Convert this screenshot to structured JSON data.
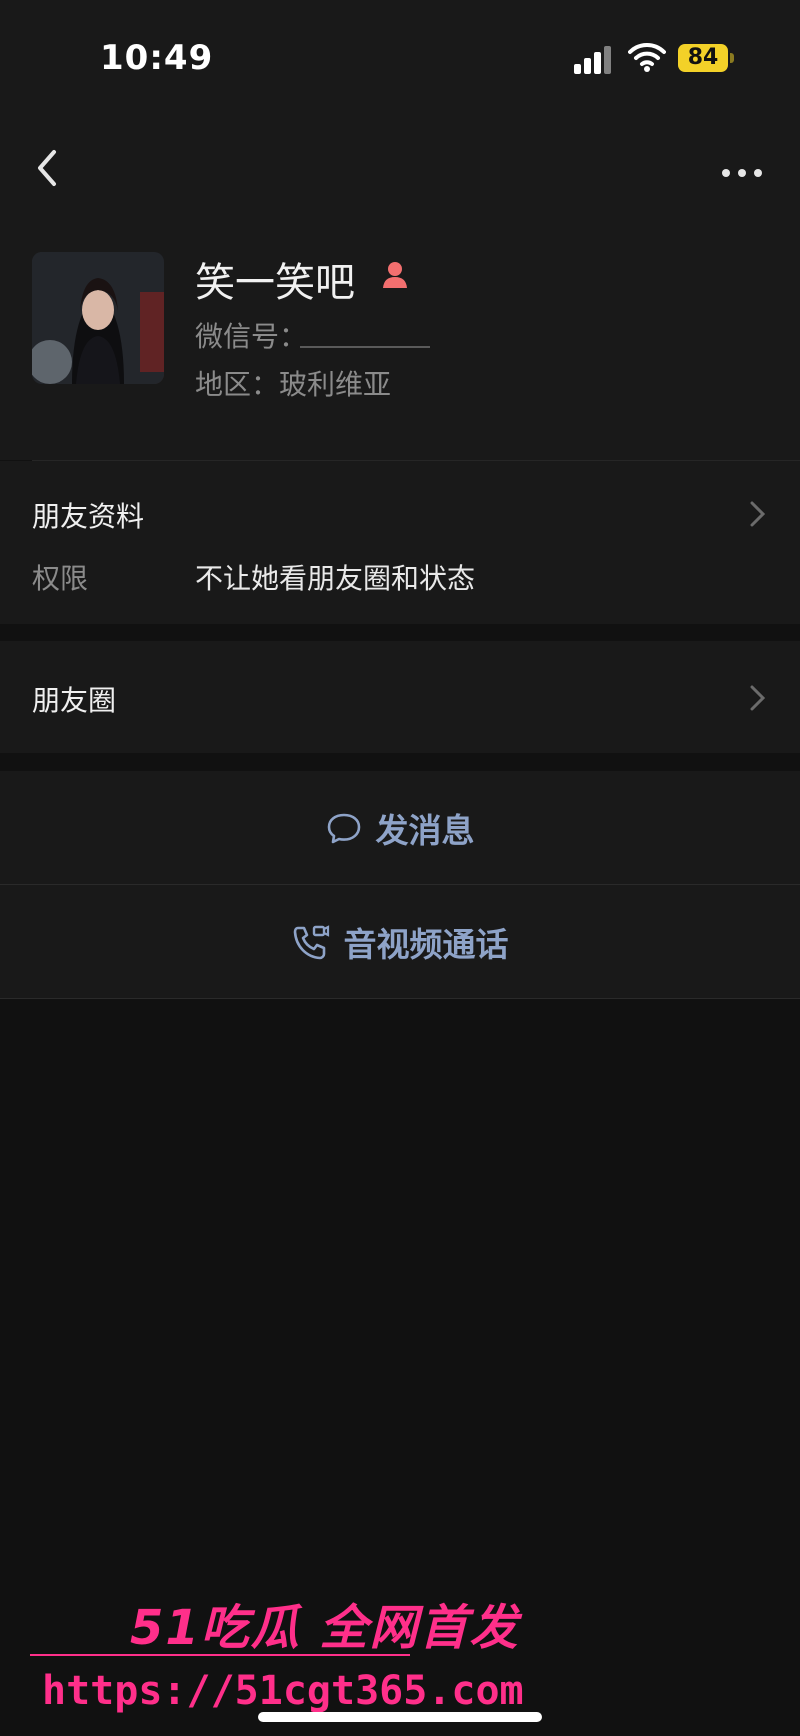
{
  "status_bar": {
    "time": "10:49",
    "battery": "84",
    "battery_color": "#f3d128"
  },
  "profile": {
    "name": "笑一笑吧",
    "wechat_id_label": "微信号：",
    "region": "地区：玻利维亚",
    "gender_icon": "female-icon",
    "gender_color": "#f26f6f"
  },
  "info": {
    "title": "朋友资料",
    "permission_label": "权限",
    "permission_value": "不让她看朋友圈和状态"
  },
  "moments": {
    "title": "朋友圈"
  },
  "actions": {
    "message_label": "发消息",
    "call_label": "音视频通话",
    "accent": "#8ea3c8"
  },
  "watermark": {
    "brand": "51吃瓜 全网首发",
    "url": "https://51cgt365.com",
    "color": "#ff2f8a"
  }
}
